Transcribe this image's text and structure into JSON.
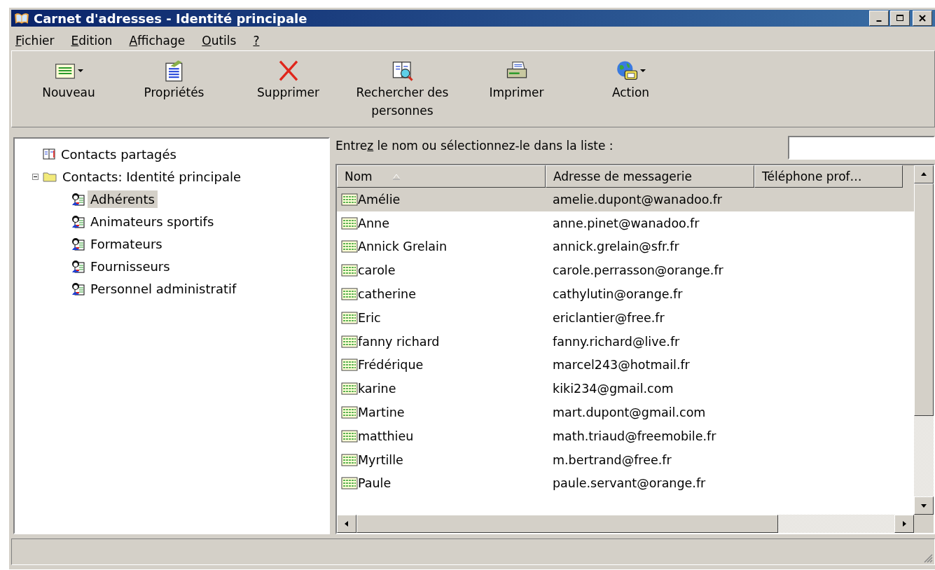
{
  "window": {
    "title": "Carnet d'adresses - Identité principale"
  },
  "menu": [
    {
      "label": "Fichier"
    },
    {
      "label": "Edition"
    },
    {
      "label": "Affichage"
    },
    {
      "label": "Outils"
    },
    {
      "label": "?"
    }
  ],
  "toolbar": [
    {
      "label": "Nouveau",
      "kind": "new",
      "dropdown": true
    },
    {
      "label": "Propriétés",
      "kind": "properties",
      "dropdown": false
    },
    {
      "label": "Supprimer",
      "kind": "delete",
      "dropdown": false
    },
    {
      "label": "Rechercher des personnes",
      "kind": "find",
      "dropdown": false
    },
    {
      "label": "Imprimer",
      "kind": "print",
      "dropdown": false
    },
    {
      "label": "Action",
      "kind": "action",
      "dropdown": true
    }
  ],
  "tree": [
    {
      "label": "Contacts partagés",
      "kind": "book",
      "selected": false
    },
    {
      "label": "Contacts: Identité principale",
      "kind": "folder",
      "selected": false,
      "expanded": true,
      "children": [
        {
          "label": "Adhérents",
          "kind": "group",
          "selected": true
        },
        {
          "label": "Animateurs sportifs",
          "kind": "group",
          "selected": false
        },
        {
          "label": "Formateurs",
          "kind": "group",
          "selected": false
        },
        {
          "label": "Fournisseurs",
          "kind": "group",
          "selected": false
        },
        {
          "label": "Personnel administratif",
          "kind": "group",
          "selected": false
        }
      ]
    }
  ],
  "search": {
    "prompt_before": "Entre",
    "prompt_accel": "z",
    "prompt_after": " le nom ou sélectionnez-le dans la liste :"
  },
  "table": {
    "columns": [
      {
        "label": "Nom",
        "sorted": true
      },
      {
        "label": "Adresse de messagerie",
        "sorted": false
      },
      {
        "label": "Téléphone prof…",
        "sorted": false
      }
    ],
    "rows": [
      {
        "name": "Amélie",
        "email": "amelie.dupont@wanadoo.fr",
        "selected": true
      },
      {
        "name": "Anne",
        "email": "anne.pinet@wanadoo.fr",
        "selected": false
      },
      {
        "name": "Annick Grelain",
        "email": "annick.grelain@sfr.fr",
        "selected": false
      },
      {
        "name": "carole",
        "email": "carole.perrasson@orange.fr",
        "selected": false
      },
      {
        "name": "catherine",
        "email": "cathylutin@orange.fr",
        "selected": false
      },
      {
        "name": "Eric",
        "email": "ericlantier@free.fr",
        "selected": false
      },
      {
        "name": "fanny richard",
        "email": "fanny.richard@live.fr",
        "selected": false
      },
      {
        "name": "Frédérique",
        "email": "marcel243@hotmail.fr",
        "selected": false
      },
      {
        "name": "karine",
        "email": "kiki234@gmail.com",
        "selected": false
      },
      {
        "name": "Martine",
        "email": "mart.dupont@gmail.com",
        "selected": false
      },
      {
        "name": "matthieu",
        "email": "math.triaud@freemobile.fr",
        "selected": false
      },
      {
        "name": "Myrtille",
        "email": "m.bertrand@free.fr",
        "selected": false
      },
      {
        "name": "Paule",
        "email": "paule.servant@orange.fr",
        "selected": false
      }
    ]
  }
}
